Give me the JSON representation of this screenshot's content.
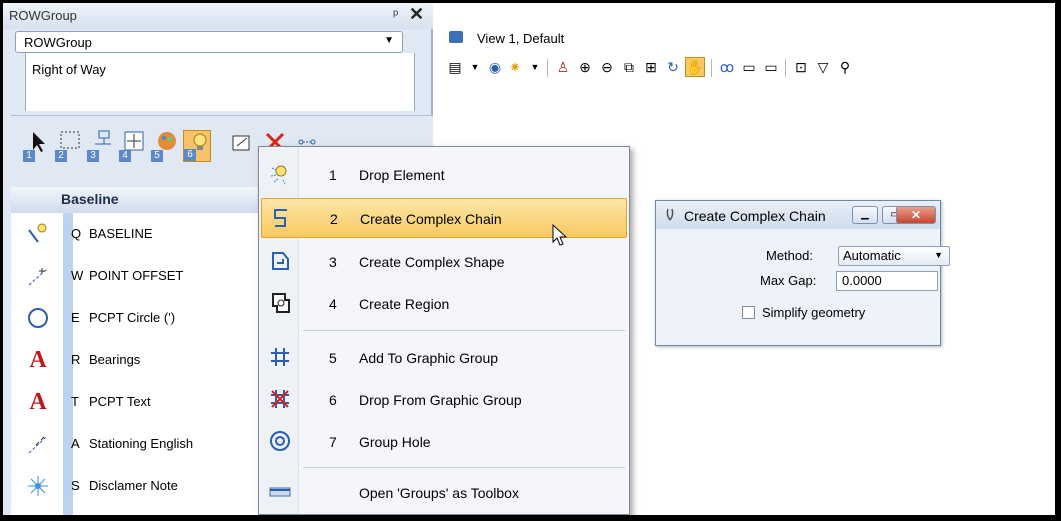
{
  "panel": {
    "title": "ROWGroup",
    "pin": "ᵖ",
    "close": "✕",
    "combo_value": "ROWGroup",
    "tab_label": "Right of Way",
    "tool_numbers": [
      "1",
      "2",
      "3",
      "4",
      "5",
      "6"
    ],
    "list_title": "Baseline",
    "items": [
      {
        "key": "Q",
        "label": "BASELINE"
      },
      {
        "key": "W",
        "label": "POINT OFFSET"
      },
      {
        "key": "E",
        "label": "PCPT Circle (')"
      },
      {
        "key": "R",
        "label": "Bearings"
      },
      {
        "key": "T",
        "label": "PCPT Text"
      },
      {
        "key": "A",
        "label": "Stationing English"
      },
      {
        "key": "S",
        "label": "Disclamer Note"
      }
    ]
  },
  "view": {
    "title": "View 1, Default"
  },
  "menu": {
    "items": [
      {
        "num": "1",
        "label": "Drop Element",
        "icon": "drop-element-icon"
      },
      {
        "num": "2",
        "label": "Create Complex Chain",
        "icon": "complex-chain-icon"
      },
      {
        "num": "3",
        "label": "Create Complex Shape",
        "icon": "complex-shape-icon"
      },
      {
        "num": "4",
        "label": "Create Region",
        "icon": "region-icon"
      },
      {
        "num": "5",
        "label": "Add To Graphic Group",
        "icon": "graphic-group-add-icon"
      },
      {
        "num": "6",
        "label": "Drop From Graphic Group",
        "icon": "graphic-group-drop-icon"
      },
      {
        "num": "7",
        "label": "Group Hole",
        "icon": "group-hole-icon"
      }
    ],
    "open_toolbox": "Open 'Groups' as Toolbox"
  },
  "dialog": {
    "title": "Create Complex Chain",
    "method_label_pre": "",
    "method_label": "Method:",
    "method_value": "Automatic",
    "max_gap_label": "Max Gap:",
    "max_gap_value": "0.0000",
    "simplify_label": "Simplify geometry"
  },
  "colors": {
    "highlight": "#f8c860",
    "panel_bg": "#dfe8f3",
    "accent": "#5b89c8"
  }
}
